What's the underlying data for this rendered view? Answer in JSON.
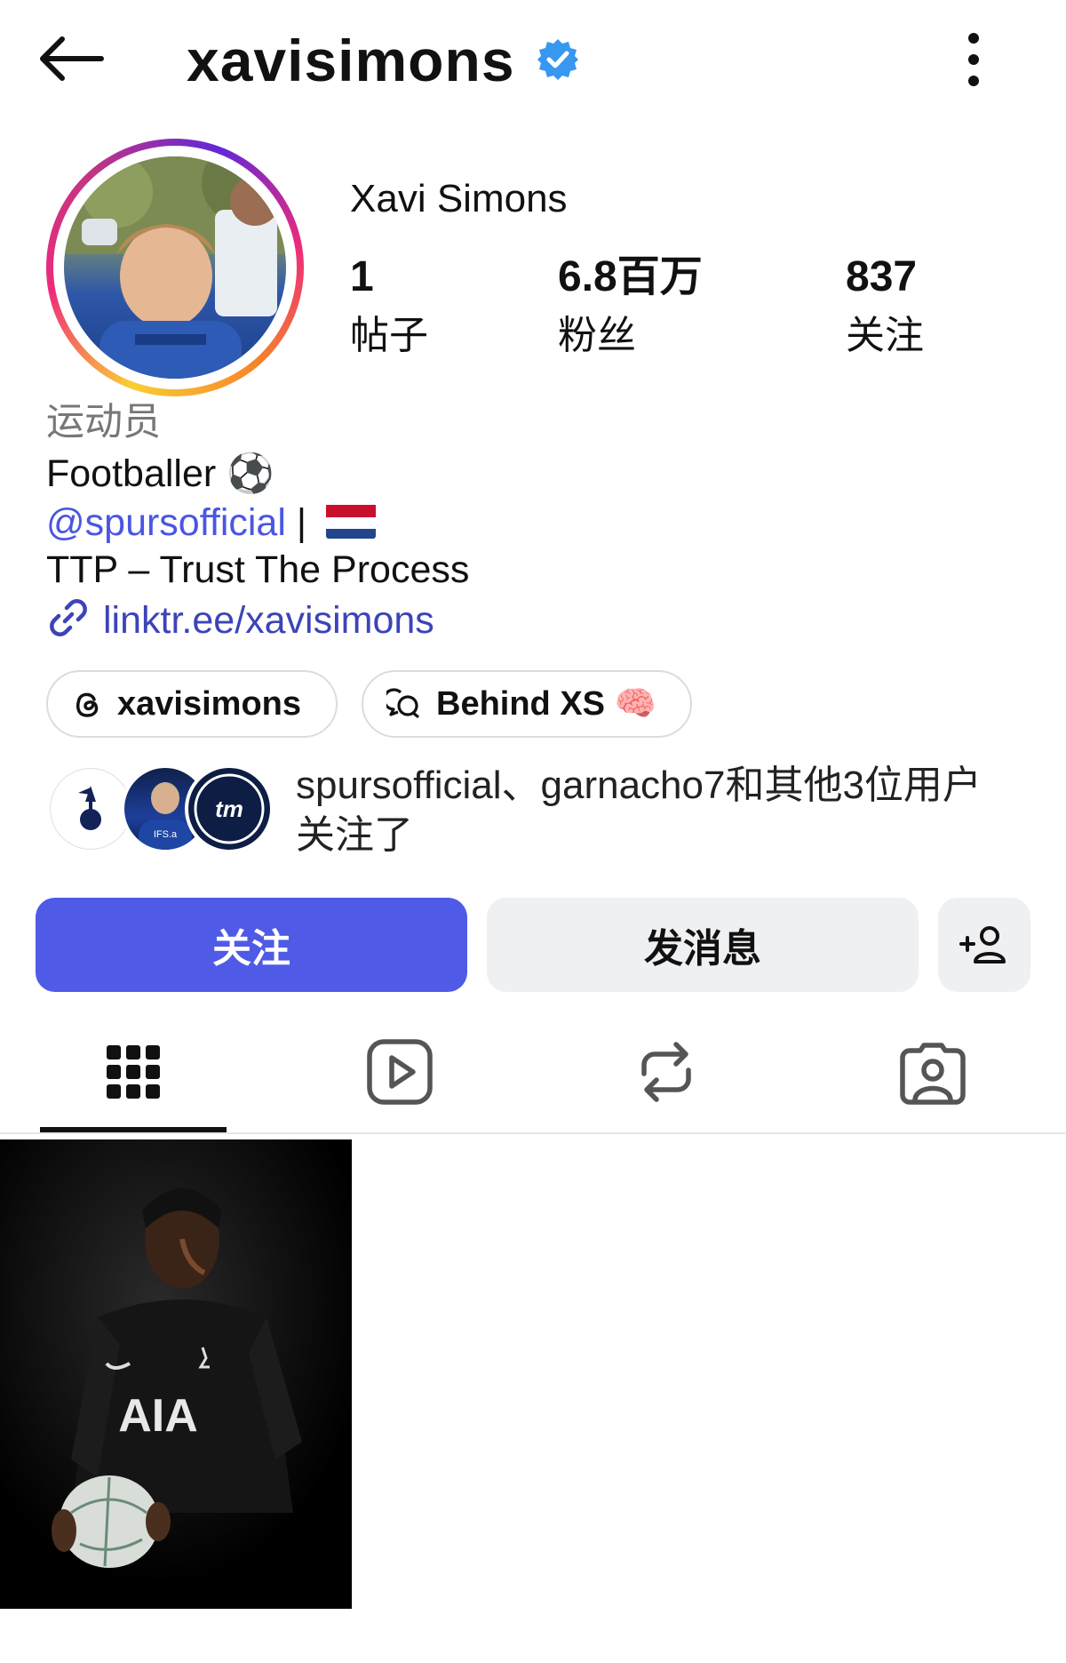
{
  "header": {
    "username": "xavisimons",
    "back_icon": "arrow-left-icon",
    "verified_icon": "verified-badge-icon",
    "more_icon": "more-vertical-icon"
  },
  "profile": {
    "display_name": "Xavi Simons",
    "stats": [
      {
        "value": "1",
        "label": "帖子"
      },
      {
        "value": "6.8百万",
        "label": "粉丝"
      },
      {
        "value": "837",
        "label": "关注"
      }
    ],
    "category": "运动员",
    "bio_line1": "Footballer ⚽",
    "mention": "@spursofficial",
    "separator": " | ",
    "bio_line3": "TTP – Trust The Process",
    "link": "linktr.ee/xavisimons"
  },
  "chips": [
    {
      "label": "xavisimons",
      "icon": "threads-icon"
    },
    {
      "label": "Behind XS 🧠",
      "icon": "chat-bubbles-icon"
    }
  ],
  "followed_by": {
    "text": "spursofficial、garnacho7和其他3位用户关注了",
    "avatar_text": [
      "IFS.a",
      "tm"
    ]
  },
  "actions": {
    "follow": "关注",
    "message": "发消息",
    "add_user_icon": "add-user-icon"
  },
  "tabs": [
    {
      "name": "grid",
      "icon": "grid-icon",
      "active": true
    },
    {
      "name": "reels",
      "icon": "reels-icon",
      "active": false
    },
    {
      "name": "reposts",
      "icon": "repost-icon",
      "active": false
    },
    {
      "name": "tagged",
      "icon": "tagged-icon",
      "active": false
    }
  ],
  "posts": [
    {
      "jersey_text": "AIA"
    }
  ],
  "colors": {
    "accent": "#4f5ae6",
    "link": "#3b44b8",
    "verified": "#3897f0",
    "secondary_button": "#eff0f2"
  }
}
